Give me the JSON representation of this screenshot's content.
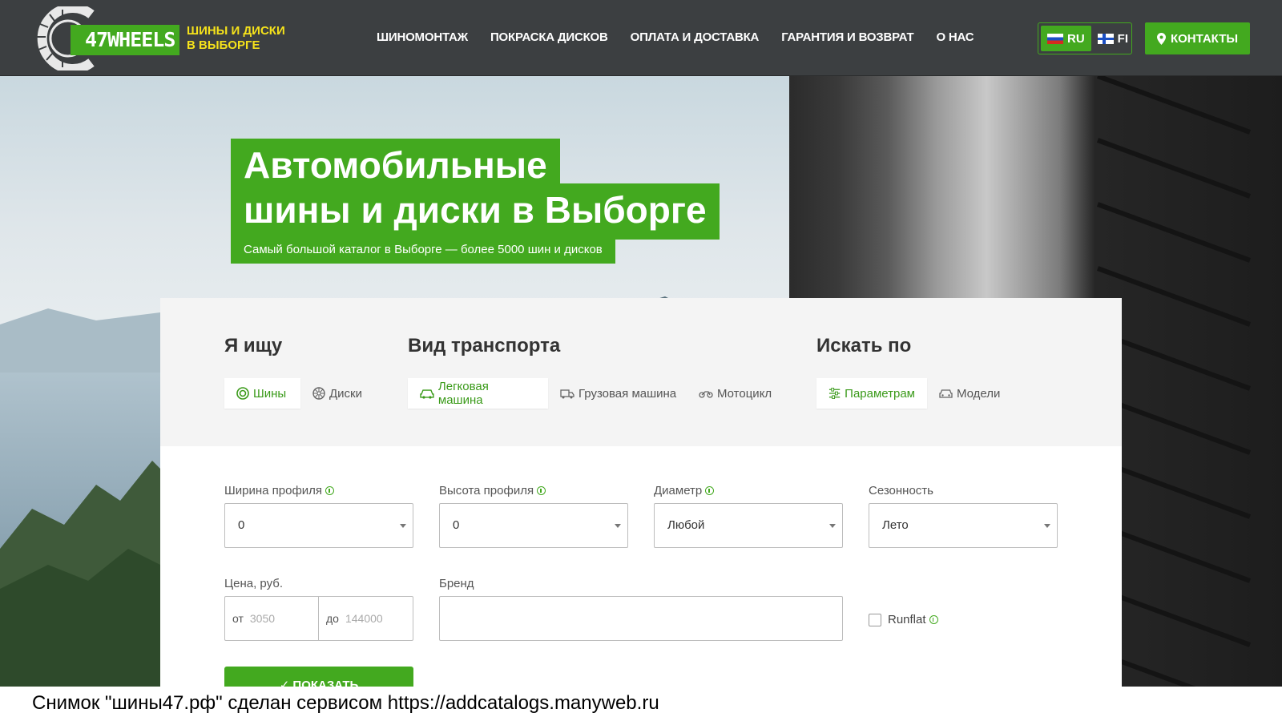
{
  "header": {
    "logo_text": "47WHEELS",
    "tagline": [
      "ШИНЫ И ДИСКИ",
      "В ВЫБОРГЕ"
    ],
    "nav": [
      "ШИНОМОНТАЖ",
      "ПОКРАСКА ДИСКОВ",
      "ОПЛАТА И ДОСТАВКА",
      "ГАРАНТИЯ И ВОЗВРАТ",
      "О НАС"
    ],
    "languages": [
      {
        "code": "RU",
        "flag": "ru-flag",
        "active": true
      },
      {
        "code": "FI",
        "flag": "fi-flag",
        "active": false
      }
    ],
    "contacts_label": "КОНТАКТЫ"
  },
  "hero": {
    "title_line1": "Автомобильные",
    "title_line2": "шины и диски в Выборге",
    "subtitle": "Самый большой каталог в Выборге — более 5000 шин и дисков"
  },
  "search": {
    "looking_for": {
      "heading": "Я ищу",
      "options": [
        {
          "label": "Шины",
          "icon": "tire-icon",
          "active": true
        },
        {
          "label": "Диски",
          "icon": "wheel-icon",
          "active": false
        }
      ]
    },
    "vehicle_type": {
      "heading": "Вид транспорта",
      "options": [
        {
          "label": "Легковая машина",
          "icon": "car-icon",
          "active": true
        },
        {
          "label": "Грузовая машина",
          "icon": "truck-icon",
          "active": false
        },
        {
          "label": "Мотоцикл",
          "icon": "motorcycle-icon",
          "active": false
        }
      ]
    },
    "search_by": {
      "heading": "Искать по",
      "options": [
        {
          "label": "Параметрам",
          "icon": "sliders-icon",
          "active": true
        },
        {
          "label": "Модели",
          "icon": "car-front-icon",
          "active": false
        }
      ]
    },
    "fields": {
      "width": {
        "label": "Ширина профиля",
        "value": "0"
      },
      "height": {
        "label": "Высота профиля",
        "value": "0"
      },
      "diameter": {
        "label": "Диаметр",
        "value": "Любой"
      },
      "season": {
        "label": "Сезонность",
        "value": "Лето"
      },
      "price": {
        "label": "Цена, руб.",
        "from_prefix": "от",
        "from_placeholder": "3050",
        "to_prefix": "до",
        "to_placeholder": "144000"
      },
      "brand": {
        "label": "Бренд",
        "value": ""
      },
      "runflat": {
        "label": "Runflat",
        "checked": false
      }
    },
    "submit_label": "✓ ПОКАЗАТЬ"
  },
  "watermark": "Снимок \"шины47.рф\" сделан сервисом https://addcatalogs.manyweb.ru",
  "colors": {
    "accent": "#43a91f",
    "header_bg": "#3c3f41",
    "tagline": "#f5e21b"
  }
}
